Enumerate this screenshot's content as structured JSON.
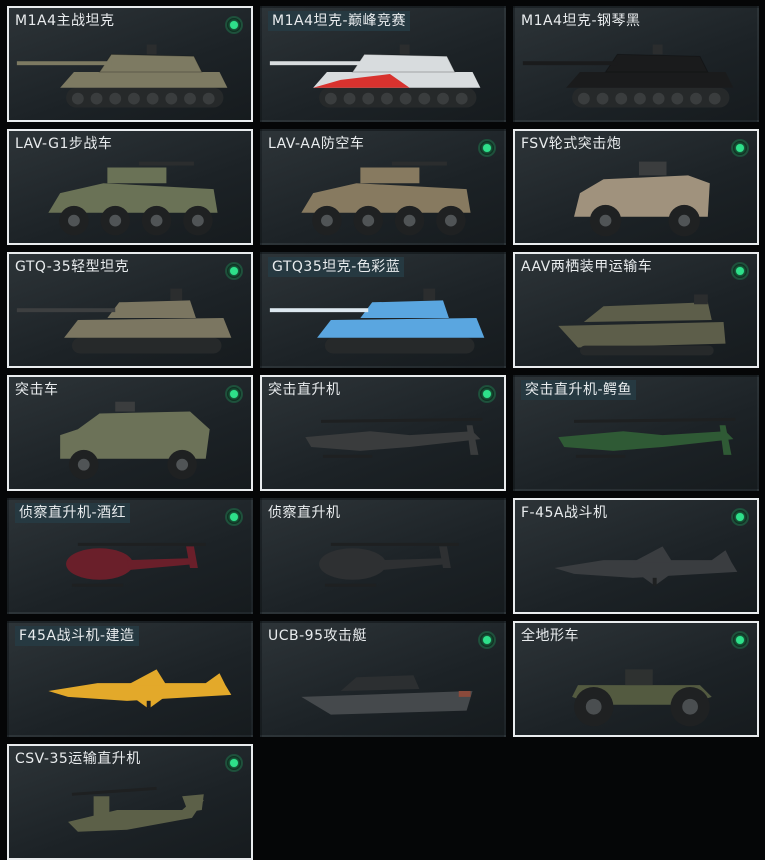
{
  "vehicles": [
    {
      "name": "M1A4主战坦克",
      "owned": true,
      "selected": true,
      "highlight": false,
      "icon": "tank-icon",
      "color": "#7d7a62"
    },
    {
      "name": "M1A4坦克-巅峰竞赛",
      "owned": false,
      "selected": false,
      "highlight": true,
      "icon": "tank-icon",
      "color": "#d8dcde",
      "accent": "#d8322e"
    },
    {
      "name": "M1A4坦克-钢琴黑",
      "owned": false,
      "selected": false,
      "highlight": false,
      "icon": "tank-icon",
      "color": "#1a1b1c"
    },
    {
      "name": "LAV-G1步战车",
      "owned": false,
      "selected": true,
      "highlight": false,
      "icon": "apc-wheeled-icon",
      "color": "#6a7256"
    },
    {
      "name": "LAV-AA防空车",
      "owned": true,
      "selected": false,
      "highlight": false,
      "icon": "apc-wheeled-icon",
      "color": "#877a60"
    },
    {
      "name": "FSV轮式突击炮",
      "owned": true,
      "selected": true,
      "highlight": false,
      "icon": "armored-car-icon",
      "color": "#a0927d"
    },
    {
      "name": "GTQ-35轻型坦克",
      "owned": true,
      "selected": true,
      "highlight": false,
      "icon": "light-tank-icon",
      "color": "#7b7661"
    },
    {
      "name": "GTQ35坦克-色彩蓝",
      "owned": false,
      "selected": false,
      "highlight": true,
      "icon": "light-tank-icon",
      "color": "#5aa6e0",
      "accent": "#dde8f0"
    },
    {
      "name": "AAV两栖装甲运输车",
      "owned": true,
      "selected": true,
      "highlight": false,
      "icon": "amphibious-icon",
      "color": "#5d5e4a"
    },
    {
      "name": "突击车",
      "owned": true,
      "selected": true,
      "highlight": false,
      "icon": "assault-car-icon",
      "color": "#6c7258"
    },
    {
      "name": "突击直升机",
      "owned": true,
      "selected": true,
      "highlight": false,
      "icon": "helicopter-icon",
      "color": "#3a3c3d"
    },
    {
      "name": "突击直升机-鳄鱼",
      "owned": false,
      "selected": false,
      "highlight": true,
      "icon": "helicopter-icon",
      "color": "#2f5a35"
    },
    {
      "name": "侦察直升机-酒红",
      "owned": true,
      "selected": false,
      "highlight": true,
      "icon": "scout-heli-icon",
      "color": "#6a1f2a"
    },
    {
      "name": "侦察直升机",
      "owned": false,
      "selected": false,
      "highlight": false,
      "icon": "scout-heli-icon",
      "color": "#2e3032"
    },
    {
      "name": "F-45A战斗机",
      "owned": true,
      "selected": true,
      "highlight": false,
      "icon": "jet-icon",
      "color": "#3a3d40"
    },
    {
      "name": "F45A战斗机-建造",
      "owned": false,
      "selected": false,
      "highlight": true,
      "icon": "jet-icon",
      "color": "#e3a92a"
    },
    {
      "name": "UCB-95攻击艇",
      "owned": true,
      "selected": false,
      "highlight": false,
      "icon": "boat-icon",
      "color": "#45494c"
    },
    {
      "name": "全地形车",
      "owned": true,
      "selected": true,
      "highlight": false,
      "icon": "atv-icon",
      "color": "#535a40"
    },
    {
      "name": "CSV-35运输直升机",
      "owned": true,
      "selected": true,
      "highlight": false,
      "icon": "tiltrotor-icon",
      "color": "#5c6048"
    }
  ]
}
